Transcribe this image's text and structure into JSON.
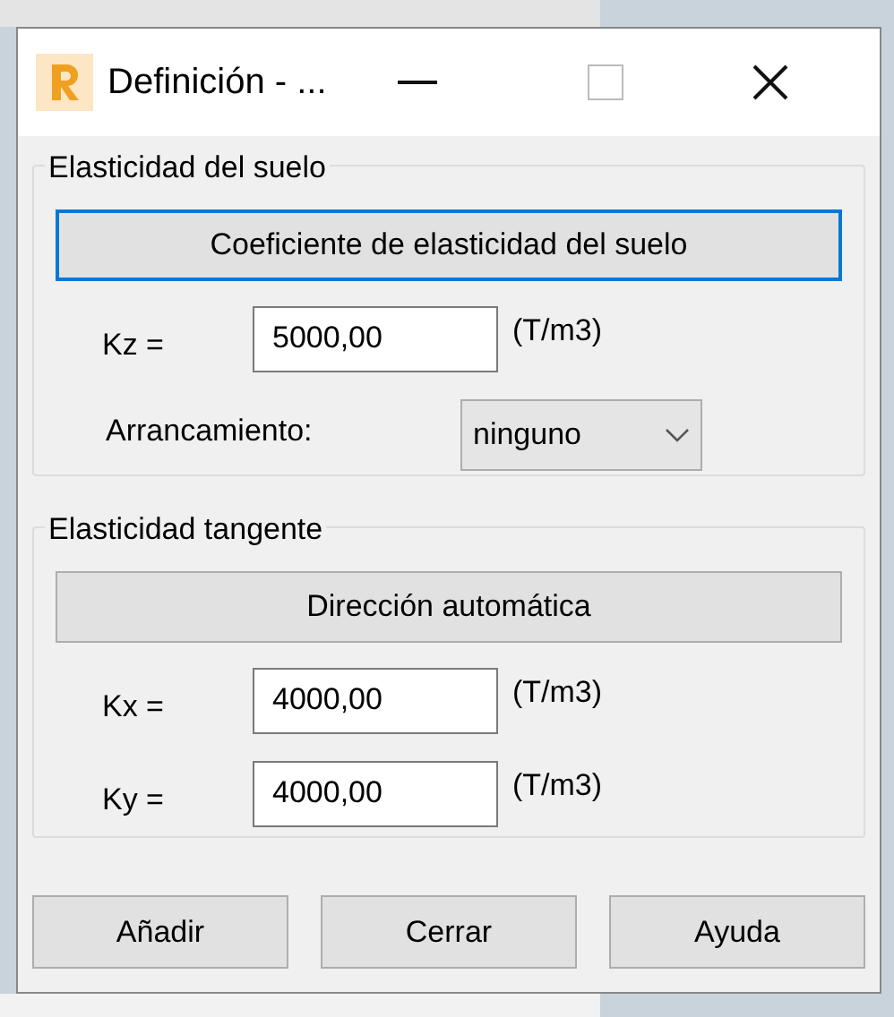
{
  "window": {
    "title": "Definición - ..."
  },
  "groups": [
    {
      "title": "Elasticidad del suelo",
      "button": {
        "label": "Coeficiente de elasticidad del suelo",
        "focused": true
      },
      "rows": [
        {
          "kind": "field",
          "label": "Kz =",
          "value": "5000,00",
          "unit": "(T/m3)"
        },
        {
          "kind": "combo",
          "label": "Arrancamiento:",
          "value": "ninguno"
        }
      ]
    },
    {
      "title": "Elasticidad tangente",
      "button": {
        "label": "Dirección automática",
        "focused": false
      },
      "rows": [
        {
          "kind": "field",
          "label": "Kx =",
          "value": "4000,00",
          "unit": "(T/m3)"
        },
        {
          "kind": "field",
          "label": "Ky =",
          "value": "4000,00",
          "unit": "(T/m3)"
        }
      ]
    }
  ],
  "buttons": [
    "Añadir",
    "Cerrar",
    "Ayuda"
  ]
}
